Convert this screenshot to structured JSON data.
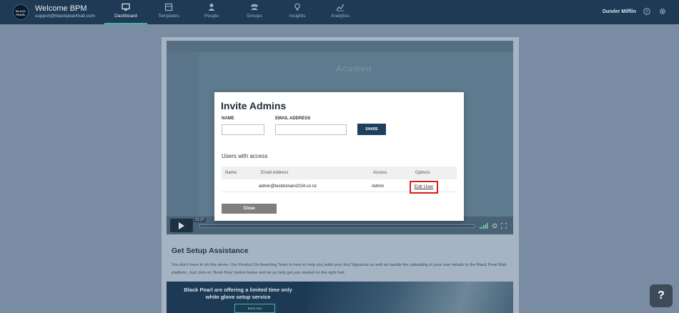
{
  "header": {
    "logo_text": "BLACK PEARL",
    "title": "Welcome BPM",
    "email": "support@blackpearlmail.com",
    "company": "Dunder Mifflin"
  },
  "nav": [
    {
      "label": "Dashboard",
      "icon": "monitor-icon"
    },
    {
      "label": "Templates",
      "icon": "templates-icon"
    },
    {
      "label": "People",
      "icon": "person-icon"
    },
    {
      "label": "Groups",
      "icon": "group-icon"
    },
    {
      "label": "Insights",
      "icon": "lightbulb-icon"
    },
    {
      "label": "Analytics",
      "icon": "line-chart-icon"
    }
  ],
  "video": {
    "logo_text": "Acumen",
    "time": "01:27"
  },
  "assist": {
    "title": "Get Setup Assistance",
    "text": "You don't have to do this alone. Our Product On-boarding Team is here to help you build your first Signature as well as handle the uploading of your user details to the Black Pearl Mail platform. Just click on 'Book Now' button below and let us help get you started on the right foot.",
    "banner_line1": "Black Pearl are offering a limited time only",
    "banner_line2": "white glove setup service",
    "book_button": "Book now"
  },
  "modal": {
    "title": "Invite Admins",
    "name_label": "NAME",
    "email_label": "EMAIL ADDRESS",
    "name_value": "",
    "email_value": "",
    "share_button": "SHARE",
    "section_title": "Users with access",
    "columns": [
      "Name",
      "Email Address",
      "Access",
      "Options"
    ],
    "rows": [
      {
        "name": "",
        "email": "admin@testdomain1024.co.nz",
        "access": "Admin",
        "option": "Edit User"
      }
    ],
    "close_button": "Close"
  },
  "help_button": "?",
  "colors": {
    "topbar": "#1f3a55",
    "accent": "#3fb7a4",
    "share": "#1e3f5e",
    "highlight": "#d81f1f"
  }
}
